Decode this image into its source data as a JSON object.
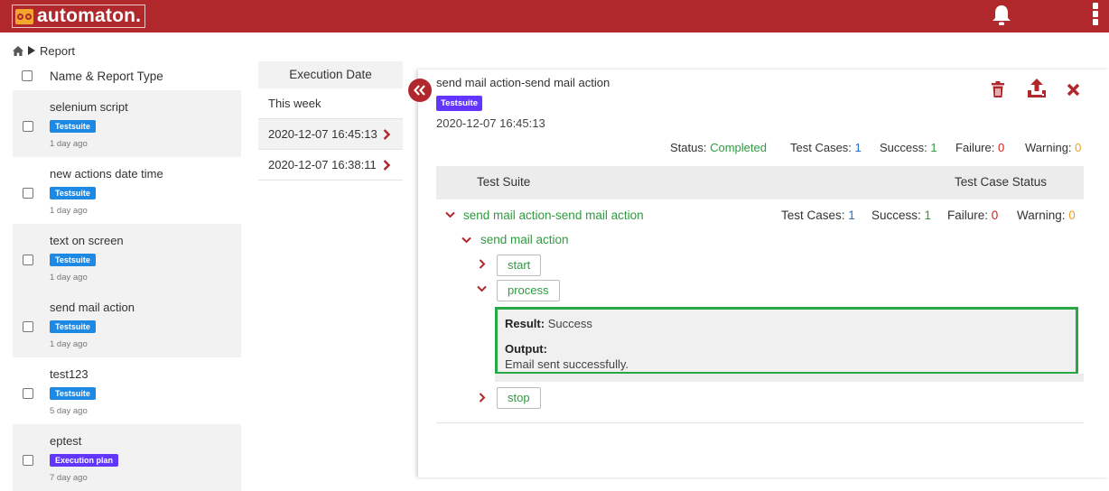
{
  "app": {
    "name": "automaton."
  },
  "breadcrumb": {
    "current": "Report"
  },
  "list": {
    "header": "Name & Report Type",
    "items": [
      {
        "name": "selenium script",
        "type": "Testsuite",
        "time": "1 day ago"
      },
      {
        "name": "new actions date time",
        "type": "Testsuite",
        "time": "1 day ago"
      },
      {
        "name": "text on screen",
        "type": "Testsuite",
        "time": "1 day ago"
      },
      {
        "name": "send mail action",
        "type": "Testsuite",
        "time": "1 day ago"
      },
      {
        "name": "test123",
        "type": "Testsuite",
        "time": "5 day ago"
      },
      {
        "name": "eptest",
        "type": "Execution plan",
        "time": "7 day ago"
      }
    ]
  },
  "execution": {
    "header": "Execution Date",
    "group": "This week",
    "rows": [
      "2020-12-07 16:45:13",
      "2020-12-07 16:38:11"
    ]
  },
  "detail": {
    "title": "send mail action-send mail action",
    "badge": "Testsuite",
    "date": "2020-12-07 16:45:13",
    "stats": {
      "status_label": "Status:",
      "status": "Completed",
      "test_cases_label": "Test Cases:",
      "test_cases": "1",
      "success_label": "Success:",
      "success": "1",
      "failure_label": "Failure:",
      "failure": "0",
      "warning_label": "Warning:",
      "warning": "0"
    },
    "table": {
      "col1": "Test Suite",
      "col2": "Test Case Status"
    },
    "suite": {
      "name": "send mail action-send mail action",
      "test_cases_label": "Test Cases:",
      "test_cases": "1",
      "success_label": "Success:",
      "success": "1",
      "failure_label": "Failure:",
      "failure": "0",
      "warning_label": "Warning:",
      "warning": "0"
    },
    "testcase": "send mail action",
    "steps": [
      "start",
      "process",
      "stop"
    ],
    "result": {
      "result_label": "Result:",
      "result": "Success",
      "output_label": "Output:",
      "output": "Email sent successfully."
    }
  },
  "colors": {
    "brand": "#b0282c",
    "success": "#2e9b3f",
    "info": "#1f6fc9",
    "danger": "#d81b1b",
    "warning": "#f0a020",
    "testsuite": "#1e88e5",
    "execution_plan": "#6236ff"
  },
  "icons": [
    "home-icon",
    "bell-icon",
    "kebab-menu-icon",
    "collapse-double-chevron-icon",
    "trash-icon",
    "upload-icon",
    "close-icon",
    "chevron-right-icon",
    "chevron-down-icon"
  ]
}
